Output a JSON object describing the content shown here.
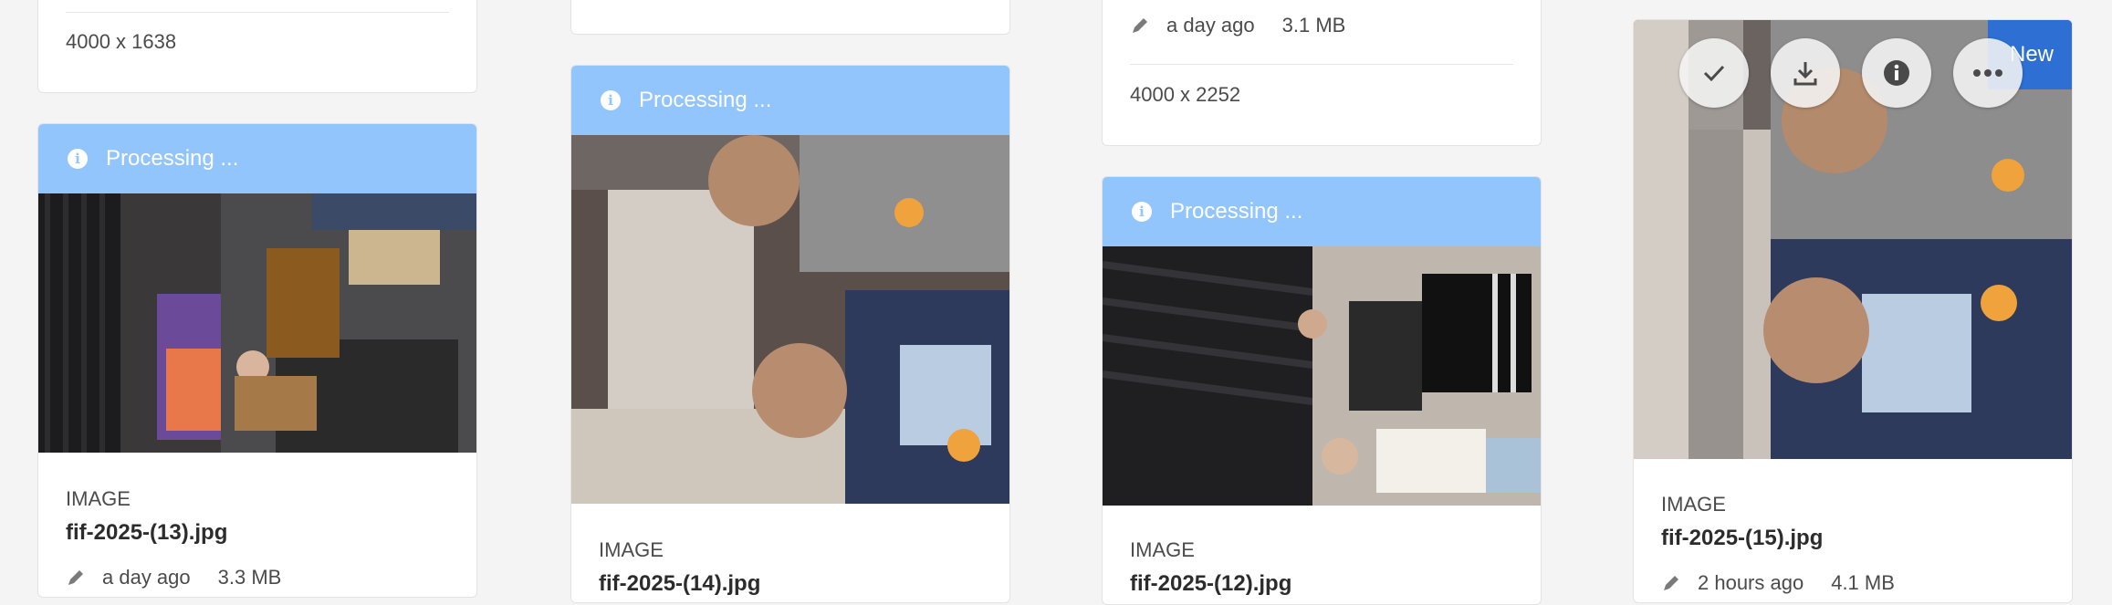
{
  "status": {
    "processing_label": "Processing ...",
    "info_glyph": "i"
  },
  "type_label": "IMAGE",
  "badge": {
    "new_label": "New"
  },
  "card1": {
    "dimensions": "4000 x 1638"
  },
  "card2": {
    "filename": "fif-2025-(13).jpg",
    "modified": "a day ago",
    "size": "3.3 MB"
  },
  "card3": {
    "filename": "fif-2025-(14).jpg"
  },
  "card4": {
    "modified": "a day ago",
    "size": "3.1 MB",
    "dimensions": "4000 x 2252"
  },
  "card5": {
    "filename": "fif-2025-(12).jpg"
  },
  "card6": {
    "filename": "fif-2025-(15).jpg",
    "modified": "2 hours ago",
    "size": "4.1 MB"
  },
  "quick_actions": [
    {
      "name": "select",
      "icon": "checkmark-icon"
    },
    {
      "name": "download",
      "icon": "download-icon"
    },
    {
      "name": "properties",
      "icon": "info-icon"
    },
    {
      "name": "more",
      "icon": "more-icon"
    }
  ],
  "colors": {
    "processing_banner": "#92c5fb",
    "new_badge": "#2d6fd2",
    "page_background": "#f4f4f4"
  }
}
